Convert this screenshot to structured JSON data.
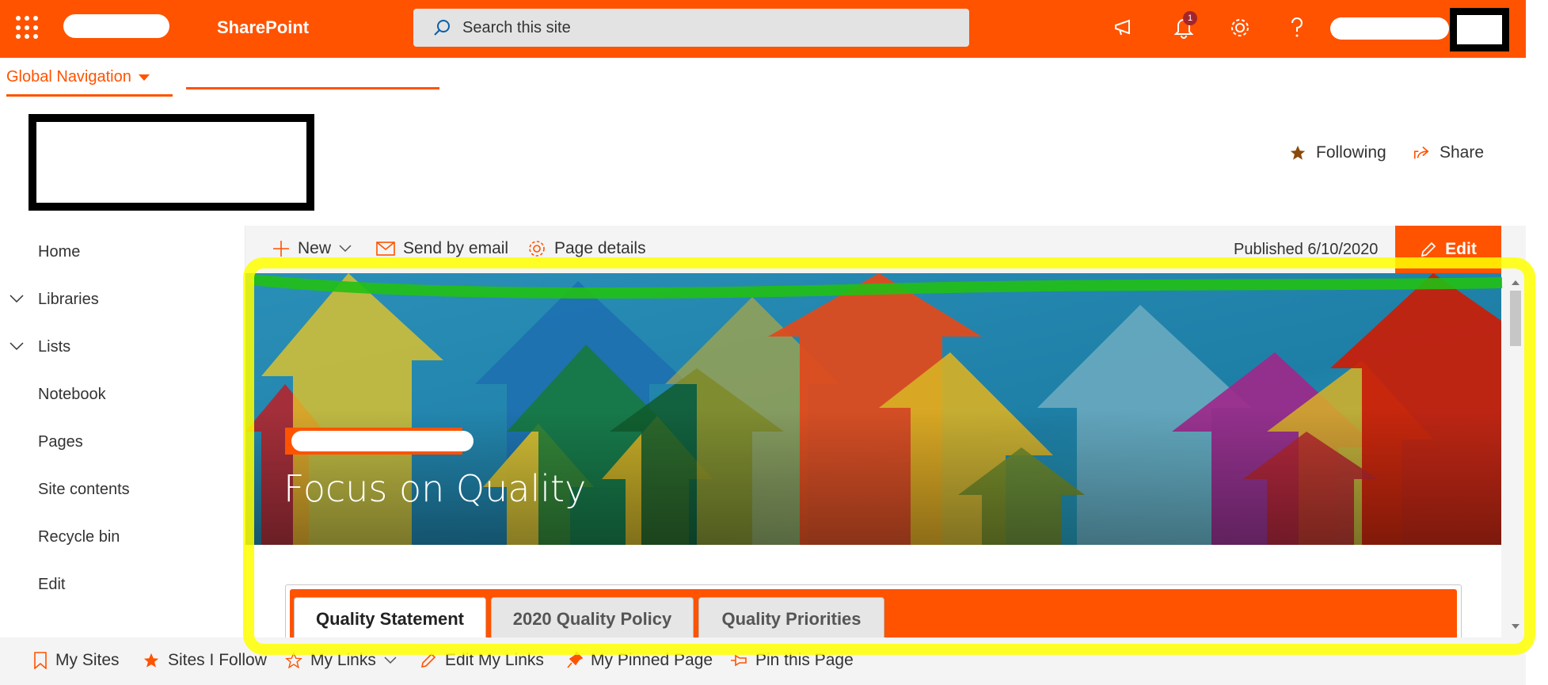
{
  "suitebar": {
    "brand": "SharePoint",
    "search_label": "Search this site",
    "notification_count": "1",
    "bg_color": "#ff5300"
  },
  "global_nav": {
    "label": "Global Navigation"
  },
  "site_header": {
    "following_label": "Following",
    "share_label": "Share"
  },
  "left_nav": {
    "items": [
      {
        "label": "Home"
      },
      {
        "label": "Libraries"
      },
      {
        "label": "Lists"
      },
      {
        "label": "Notebook"
      },
      {
        "label": "Pages"
      },
      {
        "label": "Site contents"
      },
      {
        "label": "Recycle bin"
      },
      {
        "label": "Edit"
      }
    ]
  },
  "command_bar": {
    "new_label": "New",
    "send_label": "Send by email",
    "details_label": "Page details",
    "published": "Published 6/10/2020",
    "edit_label": "Edit"
  },
  "hero": {
    "title": "Focus on Quality"
  },
  "tabs": [
    {
      "label": "Quality Statement",
      "active": true
    },
    {
      "label": "2020 Quality Policy",
      "active": false
    },
    {
      "label": "Quality Priorities",
      "active": false
    }
  ],
  "bottom_bar": {
    "my_sites": "My Sites",
    "sites_follow": "Sites I Follow",
    "my_links": "My Links",
    "edit_links": "Edit My Links",
    "pinned": "My Pinned Page",
    "pin": "Pin this Page"
  }
}
